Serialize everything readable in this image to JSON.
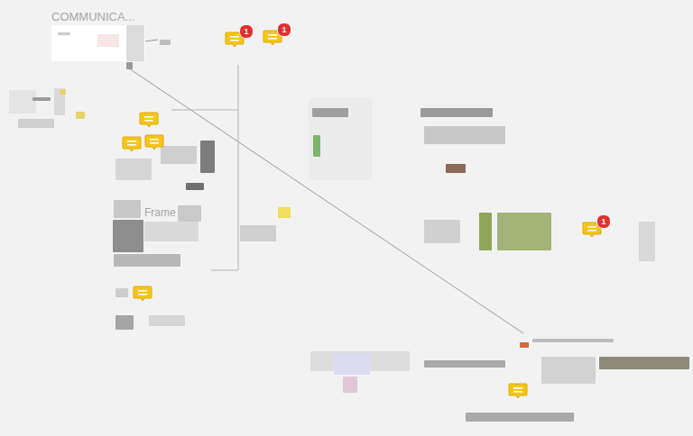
{
  "board": {
    "frames": [
      {
        "title": "COMMUNICA..."
      },
      {
        "title": "Frame"
      }
    ]
  },
  "comments": [
    {
      "unread": true,
      "badge": "1"
    },
    {
      "unread": true,
      "badge": "1"
    },
    {
      "unread": false
    },
    {
      "unread": false
    },
    {
      "unread": false
    },
    {
      "unread": true,
      "badge": "1"
    },
    {
      "unread": false
    },
    {
      "unread": false
    }
  ]
}
